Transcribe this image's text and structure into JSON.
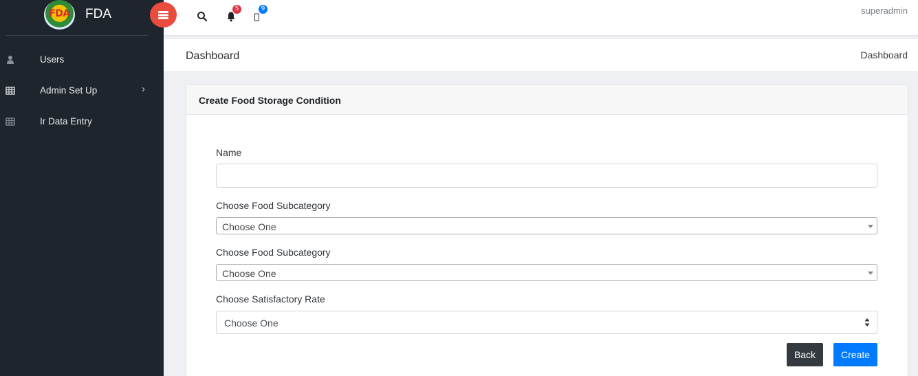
{
  "brand": {
    "logo_text": "FDA",
    "title": "FDA"
  },
  "sidebar": {
    "items": [
      {
        "label": "Users",
        "icon": "user-icon"
      },
      {
        "label": "Admin Set Up",
        "icon": "table-icon",
        "has_submenu": true
      },
      {
        "label": "Ir Data Entry",
        "icon": "table-icon"
      }
    ]
  },
  "topbar": {
    "notifications_count": "5",
    "messages_count": "9",
    "user_name": "superadmin",
    "notification_badge_color": "#dc3545",
    "message_badge_color": "#007bff",
    "toggle_color": "#e94b3c"
  },
  "page": {
    "title": "Dashboard",
    "breadcrumb": "Dashboard"
  },
  "form": {
    "card_title": "Create Food Storage Condition",
    "name_label": "Name",
    "name_value": "",
    "subcategory_label_1": "Choose Food Subcategory",
    "subcategory_value_1": "Choose One",
    "subcategory_label_2": "Choose Food Subcategory",
    "subcategory_value_2": "Choose One",
    "satisfactory_label": "Choose Satisfactory Rate",
    "satisfactory_value": "Choose One",
    "back_label": "Back",
    "create_label": "Create"
  },
  "colors": {
    "sidebar_bg": "#1f252d",
    "primary": "#007bff",
    "dark": "#343a40"
  }
}
